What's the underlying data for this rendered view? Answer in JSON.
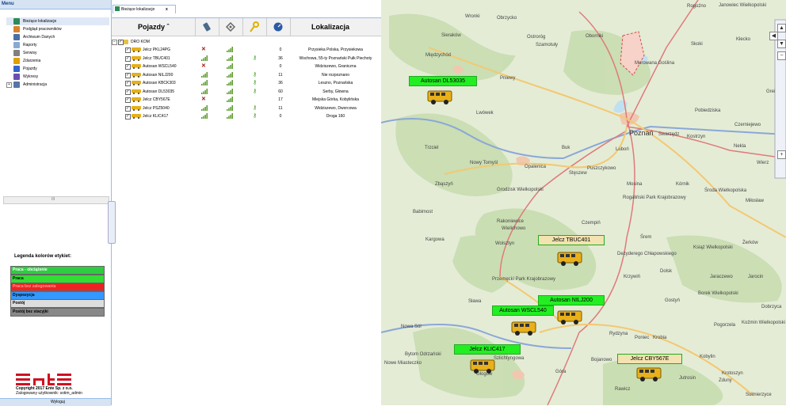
{
  "menu": {
    "title": "Menu",
    "items": [
      {
        "label": "Bieżące lokalizacje",
        "icon": "map-icon",
        "color": "#2e8b57",
        "selected": true,
        "plus": false
      },
      {
        "label": "Podgląd pracowników",
        "icon": "worker-icon",
        "color": "#d9822b",
        "selected": false,
        "plus": false
      },
      {
        "label": "Archiwum Danych",
        "icon": "archive-icon",
        "color": "#4a6fa5",
        "selected": false,
        "plus": false
      },
      {
        "label": "Raporty",
        "icon": "report-icon",
        "color": "#8aa8d0",
        "selected": false,
        "plus": false
      },
      {
        "label": "Serwisy",
        "icon": "wrench-icon",
        "color": "#7f7f7f",
        "selected": false,
        "plus": false
      },
      {
        "label": "Zdarzenia",
        "icon": "warning-icon",
        "color": "#e0a000",
        "selected": false,
        "plus": false
      },
      {
        "label": "Pojazdy",
        "icon": "car-icon",
        "color": "#3366cc",
        "selected": false,
        "plus": false
      },
      {
        "label": "Wykresy",
        "icon": "chart-icon",
        "color": "#6a4fb3",
        "selected": false,
        "plus": false
      },
      {
        "label": "Administracja",
        "icon": "admin-icon",
        "color": "#5577aa",
        "selected": false,
        "plus": true
      }
    ],
    "scroll_label": "III"
  },
  "legend": {
    "title": "Legenda kolorów etykiet:",
    "items": [
      {
        "label": "Praca - obciążenie",
        "color": "#2ecc40",
        "text": "#fff"
      },
      {
        "label": "Praca",
        "color": "#33dd33",
        "text": "#000"
      },
      {
        "label": "Praca bez zalogowania",
        "color": "#ee2222",
        "text": "#ff9999"
      },
      {
        "label": "Dyspozycja",
        "color": "#3399ff",
        "text": "#000"
      },
      {
        "label": "Postój",
        "color": "#dddddd",
        "text": "#000"
      },
      {
        "label": "Postój bez stacyjki",
        "color": "#888888",
        "text": "#000"
      }
    ]
  },
  "footer": {
    "logo_text": "ente",
    "copyright": "Copyright 2017 Ente Sp. z o.o.",
    "user": "Zalogowany użytkownik: sotim_admin",
    "logout": "Wyloguj"
  },
  "tab": {
    "label": "Bieżące lokalizacje",
    "close": "x"
  },
  "grid": {
    "col_vehicles": "Pojazdy ˆ",
    "col_location": "Lokalizacja",
    "root": "DRO KOM",
    "header_icons": [
      "phone-icon",
      "satellite-icon",
      "key-icon",
      "speed-icon"
    ],
    "rows": [
      {
        "name": "Jelcz PKL24PG",
        "gsm": "x",
        "key": false,
        "speed": "0",
        "loc": "Przysieka Polska, Przysiekowa"
      },
      {
        "name": "Jelcz TBUC401",
        "gsm": "ok",
        "key": true,
        "speed": "36",
        "loc": "Wschowa, 55-ty Poznański Pułk Piechoty"
      },
      {
        "name": "Autosan WSCL540",
        "gsm": "x",
        "key": false,
        "speed": "0",
        "loc": "Widziszewo, Graniczna"
      },
      {
        "name": "Autosan NILJ200",
        "gsm": "ok",
        "key": true,
        "speed": "11",
        "loc": "Nie rozpoznano"
      },
      {
        "name": "Autosan KBCK303",
        "gsm": "ok",
        "key": true,
        "speed": "36",
        "loc": "Leszno, Poznańska"
      },
      {
        "name": "Autosan DL53035",
        "gsm": "ok",
        "key": true,
        "speed": "60",
        "loc": "Serby, Głowna"
      },
      {
        "name": "Jelcz CBY567E",
        "gsm": "x",
        "key": false,
        "speed": "17",
        "loc": "Miejska Górka, Kobylińska"
      },
      {
        "name": "Jelcz PSZ5040",
        "gsm": "ok",
        "key": true,
        "speed": "11",
        "loc": "Widziszewo, Dworcowa"
      },
      {
        "name": "Jelcz KLIC417",
        "gsm": "ok",
        "key": true,
        "speed": "0",
        "loc": "Droga 160"
      }
    ]
  },
  "map": {
    "towns": [
      {
        "t": "Wronki",
        "big": false
      },
      {
        "t": "Obrzycko",
        "big": false
      },
      {
        "t": "Rogoźno",
        "big": false
      },
      {
        "t": "Janowiec Wielkopolski",
        "big": false
      },
      {
        "t": "Sieraków",
        "big": false
      },
      {
        "t": "Ostroróg",
        "big": false
      },
      {
        "t": "Szamotuły",
        "big": false
      },
      {
        "t": "Oborniki",
        "big": false
      },
      {
        "t": "Skoki",
        "big": false
      },
      {
        "t": "Kłecko",
        "big": false
      },
      {
        "t": "Międzychód",
        "big": false
      },
      {
        "t": "Murowana Goślina",
        "big": false
      },
      {
        "t": "Pniewy",
        "big": false
      },
      {
        "t": "Lwówek",
        "big": false
      },
      {
        "t": "Pobiedziska",
        "big": false
      },
      {
        "t": "Poznań",
        "big": true
      },
      {
        "t": "Swarzędz",
        "big": false
      },
      {
        "t": "Kostrzyn",
        "big": false
      },
      {
        "t": "Czerniejewo",
        "big": false
      },
      {
        "t": "Trzciel",
        "big": false
      },
      {
        "t": "Buk",
        "big": false
      },
      {
        "t": "Luboń",
        "big": false
      },
      {
        "t": "Nekla",
        "big": false
      },
      {
        "t": "Nowy Tomyśl",
        "big": false
      },
      {
        "t": "Opalenica",
        "big": false
      },
      {
        "t": "Stęszew",
        "big": false
      },
      {
        "t": "Puszczykowo",
        "big": false
      },
      {
        "t": "Zbąszyń",
        "big": false
      },
      {
        "t": "Mosina",
        "big": false
      },
      {
        "t": "Kórnik",
        "big": false
      },
      {
        "t": "Środa Wielkopolska",
        "big": false
      },
      {
        "t": "Grodzisk Wielkopolski",
        "big": false
      },
      {
        "t": "Rogaliński Park Krajobrazowy",
        "big": false
      },
      {
        "t": "Miłosław",
        "big": false
      },
      {
        "t": "Babimost",
        "big": false
      },
      {
        "t": "Rakoniewice",
        "big": false
      },
      {
        "t": "Wielichowo",
        "big": false
      },
      {
        "t": "Czempiń",
        "big": false
      },
      {
        "t": "Wolsztyn",
        "big": false
      },
      {
        "t": "Kargowa",
        "big": false
      },
      {
        "t": "Śrem",
        "big": false
      },
      {
        "t": "Książ Wielkopolski",
        "big": false
      },
      {
        "t": "Żerków",
        "big": false
      },
      {
        "t": "Dezyderego Chłapowskiego",
        "big": false
      },
      {
        "t": "Krzywiń",
        "big": false
      },
      {
        "t": "Dolsk",
        "big": false
      },
      {
        "t": "Jaraczewo",
        "big": false
      },
      {
        "t": "Jarocin",
        "big": false
      },
      {
        "t": "Przemęcki Park Krajobrazowy",
        "big": false
      },
      {
        "t": "Borek Wielkopolski",
        "big": false
      },
      {
        "t": "Sława",
        "big": false
      },
      {
        "t": "Gostyń",
        "big": false
      },
      {
        "t": "Dobrzyca",
        "big": false
      },
      {
        "t": "Nowa Sól",
        "big": false
      },
      {
        "t": "Rydzyna",
        "big": false
      },
      {
        "t": "Poniec",
        "big": false
      },
      {
        "t": "Krobia",
        "big": false
      },
      {
        "t": "Pogorzela",
        "big": false
      },
      {
        "t": "Koźmin Wielkopolski",
        "big": false
      },
      {
        "t": "Bytom Odrzański",
        "big": false
      },
      {
        "t": "Szlichtyngowa",
        "big": false
      },
      {
        "t": "Nowe Miasteczko",
        "big": false
      },
      {
        "t": "Głogów",
        "big": false
      },
      {
        "t": "Góra",
        "big": false
      },
      {
        "t": "Bojanowo",
        "big": false
      },
      {
        "t": "Kobylin",
        "big": false
      },
      {
        "t": "Krotoszyn",
        "big": false
      },
      {
        "t": "Jutrosin",
        "big": false
      },
      {
        "t": "Zduny",
        "big": false
      },
      {
        "t": "Rawicz",
        "big": false
      },
      {
        "t": "Sulmierzyce",
        "big": false
      },
      {
        "t": "Grei",
        "big": false
      },
      {
        "t": "Wierz",
        "big": false
      }
    ],
    "vehicle_labels": [
      {
        "label": "Autosan DL53035",
        "bg": "#22ee22"
      },
      {
        "label": "Jelcz TBUC401",
        "bg": "#f3e3b0"
      },
      {
        "label": "Autosan NILJ200",
        "bg": "#22ee22"
      },
      {
        "label": "Autosan WSCL540",
        "bg": "#22ee22"
      },
      {
        "label": "Jelcz KLIC417",
        "bg": "#22ee22"
      },
      {
        "label": "Jelcz CBY567E",
        "bg": "#f3e3b0"
      }
    ],
    "zoom_in": "+",
    "zoom_out": "−"
  }
}
